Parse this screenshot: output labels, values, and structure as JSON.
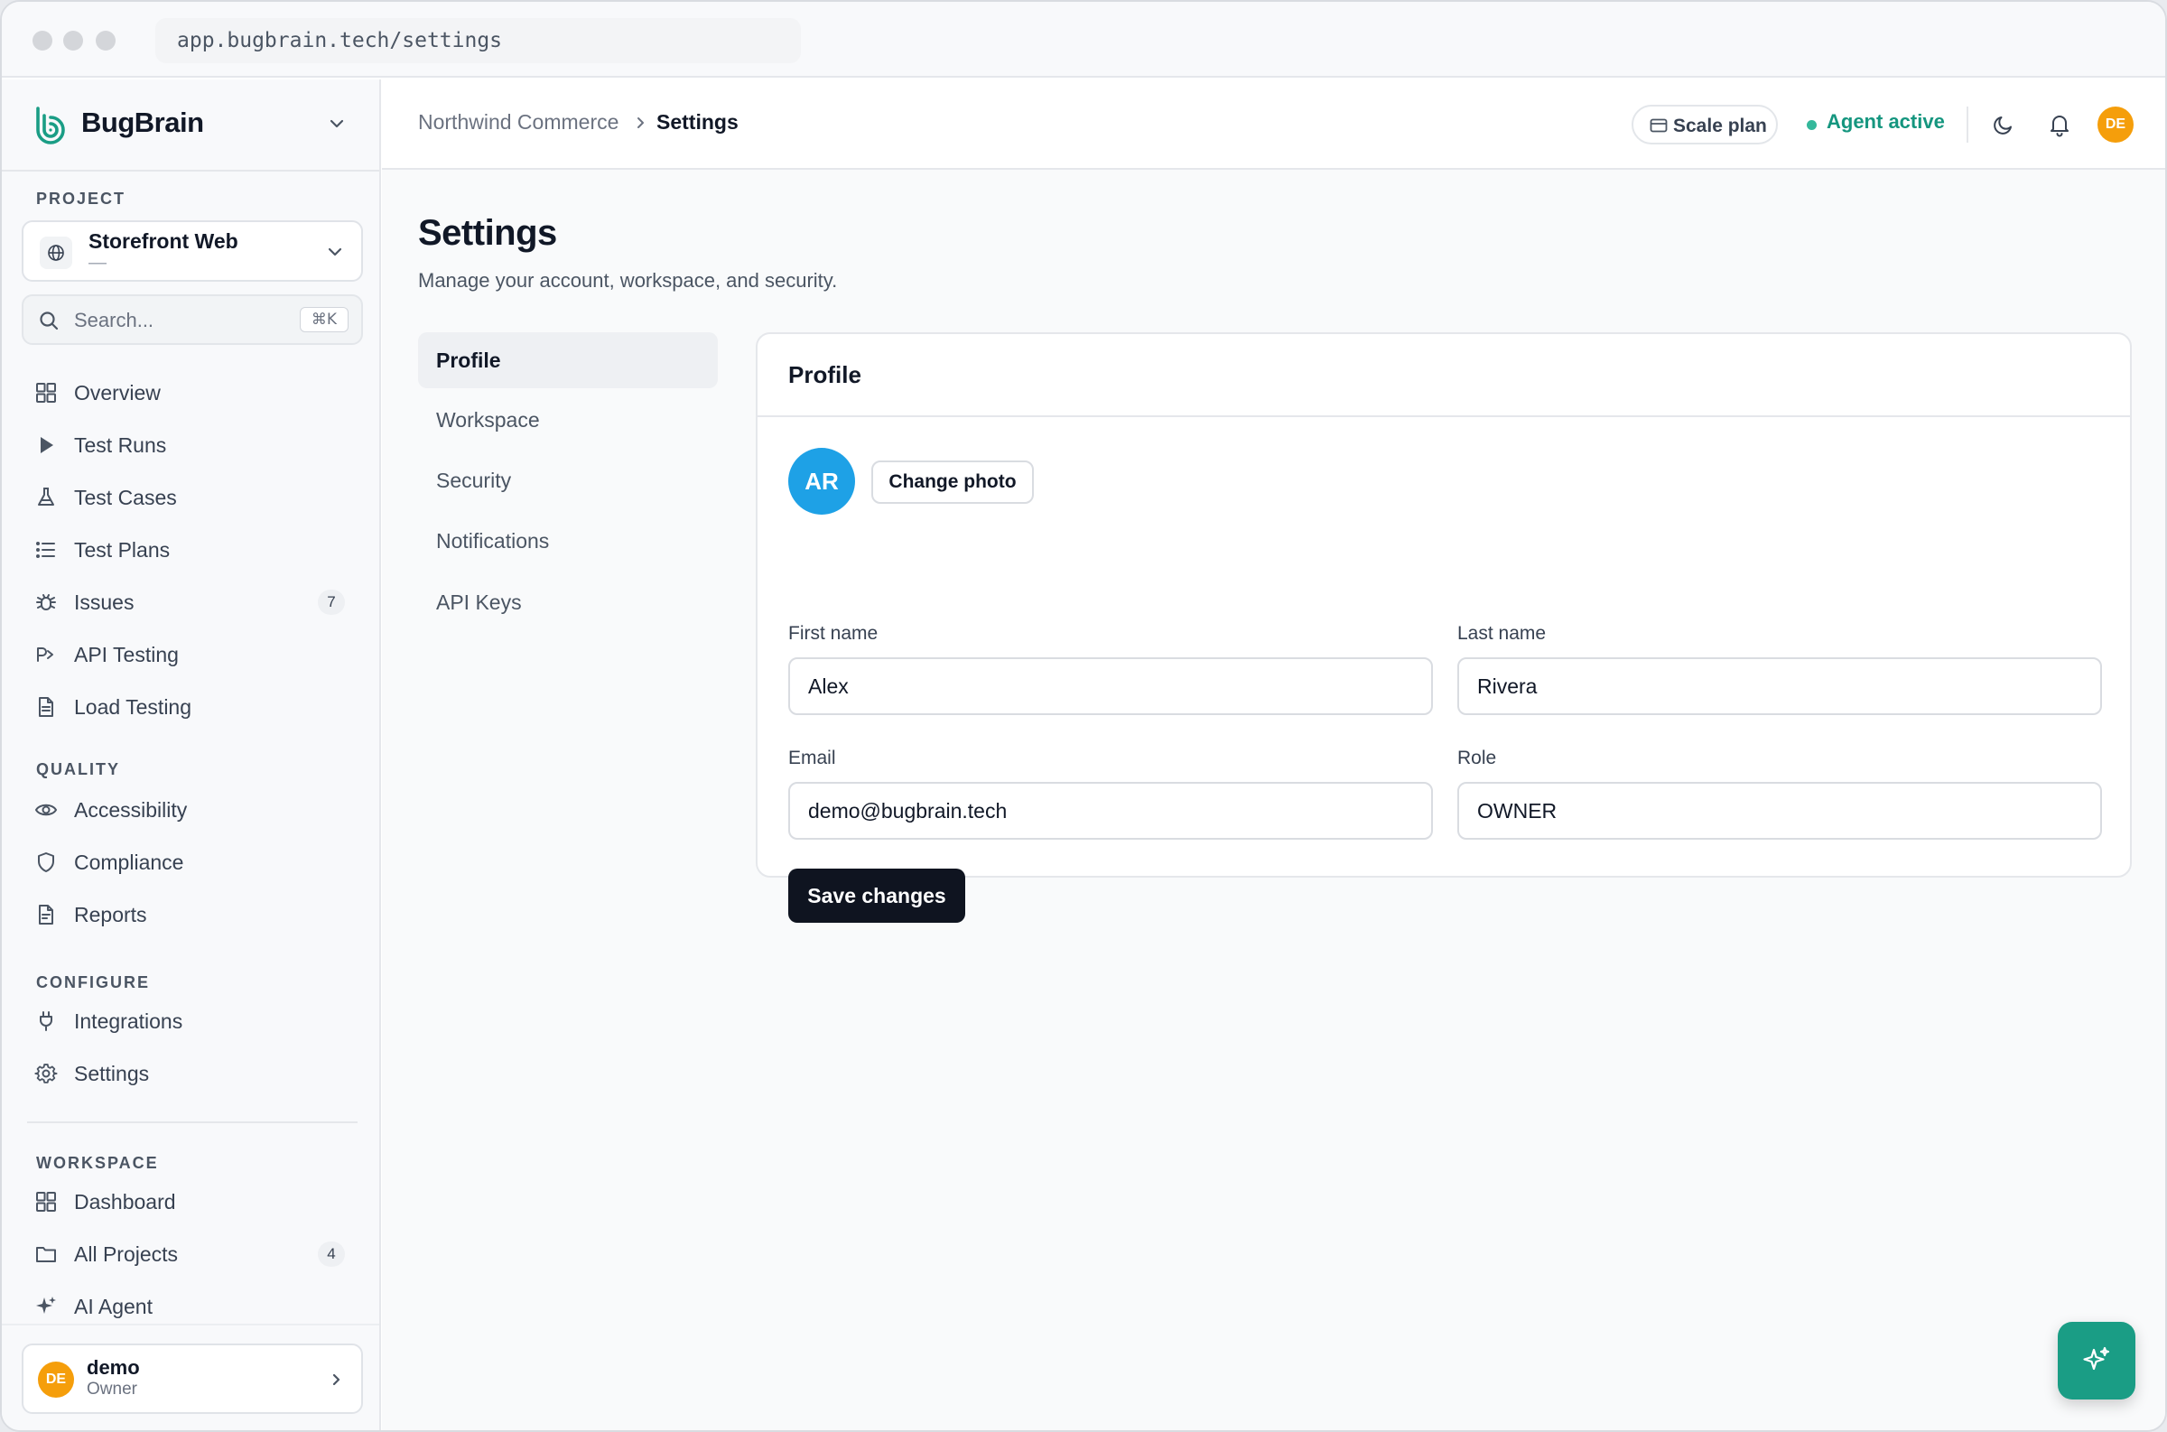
{
  "browser": {
    "url": "app.bugbrain.tech/settings"
  },
  "brand": {
    "name": "BugBrain"
  },
  "sidebar": {
    "project_label": "PROJECT",
    "project": {
      "name": "Storefront Web",
      "subtitle": "—"
    },
    "search": {
      "placeholder": "Search...",
      "shortcut": "⌘K"
    },
    "main_items": [
      {
        "label": "Overview",
        "icon": "grid-icon"
      },
      {
        "label": "Test Runs",
        "icon": "play-icon"
      },
      {
        "label": "Test Cases",
        "icon": "flask-icon"
      },
      {
        "label": "Test Plans",
        "icon": "list-icon"
      },
      {
        "label": "Issues",
        "icon": "bug-icon",
        "badge": "7"
      },
      {
        "label": "API Testing",
        "icon": "api-icon"
      },
      {
        "label": "Load Testing",
        "icon": "file-icon"
      }
    ],
    "quality_label": "QUALITY",
    "quality_items": [
      {
        "label": "Accessibility",
        "icon": "eye-icon"
      },
      {
        "label": "Compliance",
        "icon": "shield-icon"
      },
      {
        "label": "Reports",
        "icon": "report-icon"
      }
    ],
    "configure_label": "CONFIGURE",
    "configure_items": [
      {
        "label": "Integrations",
        "icon": "plug-icon"
      },
      {
        "label": "Settings",
        "icon": "gear-icon"
      }
    ],
    "workspace_label": "WORKSPACE",
    "workspace_items": [
      {
        "label": "Dashboard",
        "icon": "grid-icon"
      },
      {
        "label": "All Projects",
        "icon": "folder-icon",
        "badge": "4"
      },
      {
        "label": "AI Agent",
        "icon": "sparkle-icon"
      }
    ],
    "user": {
      "initials": "DE",
      "name": "demo",
      "role": "Owner"
    }
  },
  "topbar": {
    "breadcrumb": [
      "Northwind Commerce",
      "Settings"
    ],
    "plan": "Scale plan",
    "agent_status": "Agent active",
    "avatar_initials": "DE"
  },
  "page": {
    "title": "Settings",
    "subtitle": "Manage your account, workspace, and security."
  },
  "tabs": [
    "Profile",
    "Workspace",
    "Security",
    "Notifications",
    "API Keys"
  ],
  "active_tab": "Profile",
  "profile": {
    "card_title": "Profile",
    "avatar_initials": "AR",
    "change_photo": "Change photo",
    "first_name_label": "First name",
    "first_name": "Alex",
    "last_name_label": "Last name",
    "last_name": "Rivera",
    "email_label": "Email",
    "email": "demo@bugbrain.tech",
    "role_label": "Role",
    "role": "OWNER",
    "save_label": "Save changes"
  },
  "colors": {
    "accent": "#1a9d85",
    "avatar_user": "#f59e0b",
    "avatar_profile": "#1ea1e6",
    "primary_button": "#0f1420"
  }
}
